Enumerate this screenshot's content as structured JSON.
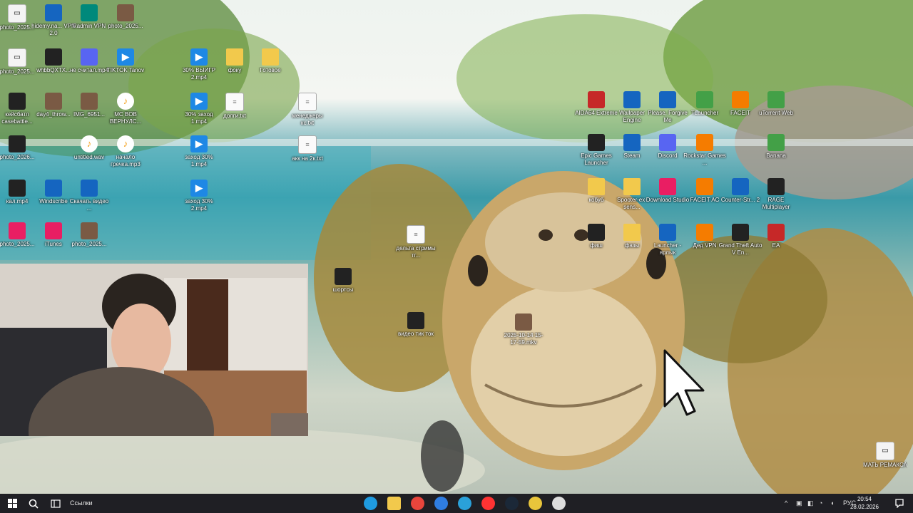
{
  "desktop": {
    "icons": [
      {
        "label": "photo_2025...",
        "kind": "file"
      },
      {
        "label": "hidemy.na... VPN 2.0",
        "kind": "blue"
      },
      {
        "label": "Radmin VPN",
        "kind": "teal"
      },
      {
        "label": "photo_2025...",
        "kind": "img"
      },
      {
        "label": "photo_2025...",
        "kind": "file"
      },
      {
        "label": "whbbQXTX...",
        "kind": "dark"
      },
      {
        "label": "не считал.mp4",
        "kind": "purple"
      },
      {
        "label": "TIKTOK Tanov",
        "kind": "video"
      },
      {
        "label": "30% ВЫИГР 2.mp4",
        "kind": "video"
      },
      {
        "label": "фоку",
        "kind": "folder"
      },
      {
        "label": "Готовое",
        "kind": "folder"
      },
      {
        "label": "кейсбатл casebattle...",
        "kind": "dark"
      },
      {
        "label": "day4_throw...",
        "kind": "img"
      },
      {
        "label": "IMG_6951...",
        "kind": "img"
      },
      {
        "label": "MC BOB ВЕРНУЛС...",
        "kind": "audio"
      },
      {
        "label": "30% заход 1.mp4",
        "kind": "video"
      },
      {
        "label": "долги.txt",
        "kind": "txt"
      },
      {
        "label": "менеджеры кс.txt",
        "kind": "txt"
      },
      {
        "label": "photo_2026...",
        "kind": "dark"
      },
      {
        "label": "untitled.wav",
        "kind": "audio"
      },
      {
        "label": "начало гречка.mp3",
        "kind": "audio"
      },
      {
        "label": "заход 30% 1.mp4",
        "kind": "video"
      },
      {
        "label": "акк на 2к.txt",
        "kind": "txt"
      },
      {
        "label": "кал.mp4",
        "kind": "dark"
      },
      {
        "label": "Windscribe",
        "kind": "blue"
      },
      {
        "label": "Скачать видео ...",
        "kind": "blue"
      },
      {
        "label": "заход 30% 2.mp4",
        "kind": "video"
      },
      {
        "label": "photo_2025...",
        "kind": "pink"
      },
      {
        "label": "iTunes",
        "kind": "pink"
      },
      {
        "label": "photo_2025...",
        "kind": "img"
      },
      {
        "label": "дельта стримы тг...",
        "kind": "txt"
      },
      {
        "label": "шортсы",
        "kind": "dark"
      },
      {
        "label": "видео тик ток",
        "kind": "dark"
      },
      {
        "label": "2025-10-14 15-17-59.mkv",
        "kind": "img"
      },
      {
        "label": "AIDA64 Extreme",
        "kind": "red"
      },
      {
        "label": "Wallpaper Engine",
        "kind": "blue"
      },
      {
        "label": "Please, Forgive Me",
        "kind": "blue"
      },
      {
        "label": "TLauncher",
        "kind": "green"
      },
      {
        "label": "FACEIT",
        "kind": "orange"
      },
      {
        "label": "uTorrent Web",
        "kind": "green"
      },
      {
        "label": "Epic Games Launcher",
        "kind": "dark"
      },
      {
        "label": "Steam",
        "kind": "blue"
      },
      {
        "label": "Discord",
        "kind": "purple"
      },
      {
        "label": "Rockstar Games ...",
        "kind": "orange"
      },
      {
        "label": "Banana",
        "kind": "green"
      },
      {
        "label": "кобуб",
        "kind": "folder"
      },
      {
        "label": "Spooter-ex-sens...",
        "kind": "folder"
      },
      {
        "label": "Download Studio",
        "kind": "pink"
      },
      {
        "label": "FACEIT AC",
        "kind": "orange"
      },
      {
        "label": "Counter-Str... 2",
        "kind": "blue"
      },
      {
        "label": "RAGE Multiplayer",
        "kind": "dark"
      },
      {
        "label": "фиш",
        "kind": "dark"
      },
      {
        "label": "фазы",
        "kind": "folder"
      },
      {
        "label": "Launcher - ярлык",
        "kind": "blue"
      },
      {
        "label": "Дед VPN",
        "kind": "orange"
      },
      {
        "label": "Grand Theft Auto V En...",
        "kind": "dark"
      },
      {
        "label": "EA",
        "kind": "red"
      },
      {
        "label": "МАТЬ РЕМАКСА",
        "kind": "file"
      }
    ]
  },
  "taskbar": {
    "search_label": "Ссылки",
    "apps": [
      {
        "name": "edge-icon",
        "color": "#1f9be0"
      },
      {
        "name": "explorer-icon",
        "color": "#f2c94c"
      },
      {
        "name": "chrome-icon",
        "color": "#e8453c"
      },
      {
        "name": "vpn-check-icon",
        "color": "#2f7de1"
      },
      {
        "name": "telegram-icon",
        "color": "#2aa1da"
      },
      {
        "name": "yandex-icon",
        "color": "#ff3333"
      },
      {
        "name": "steam-icon",
        "color": "#1b2838"
      },
      {
        "name": "game-icon",
        "color": "#e9c53b"
      },
      {
        "name": "recorder-icon",
        "color": "#dddddd"
      }
    ],
    "language": "РУС",
    "time": "20:54",
    "date": "28.02.2026"
  }
}
